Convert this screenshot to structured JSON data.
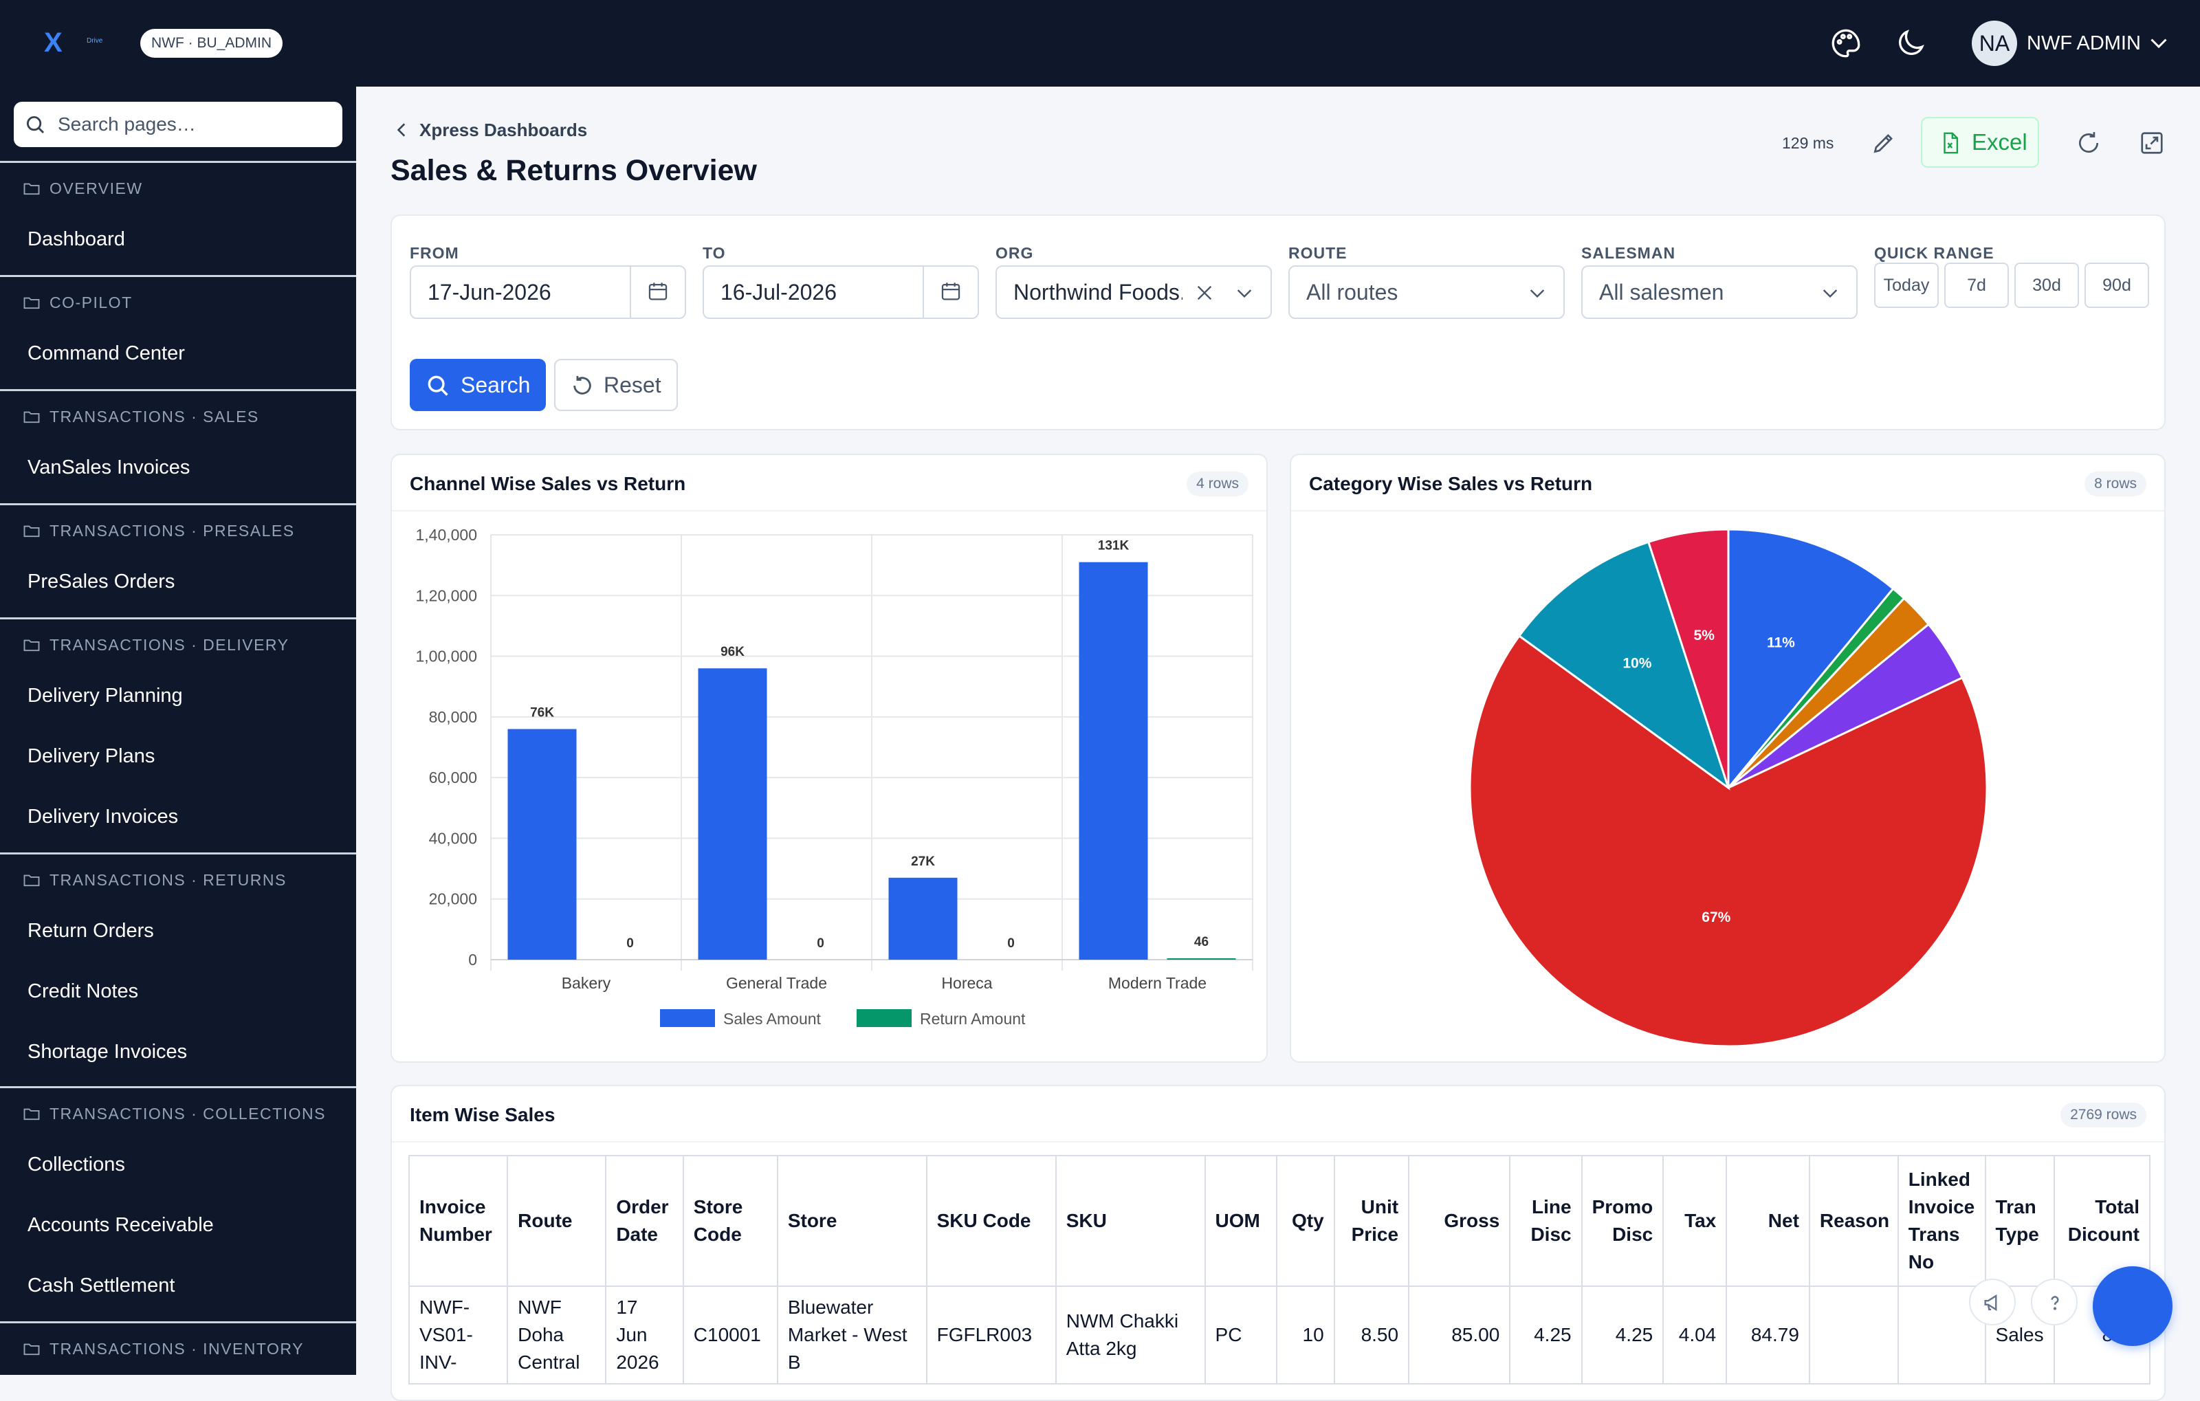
{
  "brand": {
    "logo_text": "X",
    "logo_sub": "Drive"
  },
  "tenant_badge": "NWF · BU_ADMIN",
  "user": {
    "initials": "NA",
    "name": "NWF ADMIN"
  },
  "sidebar": {
    "search_placeholder": "Search pages…",
    "sections": [
      {
        "title": "OVERVIEW",
        "items": [
          "Dashboard"
        ]
      },
      {
        "title": "CO-PILOT",
        "items": [
          "Command Center"
        ]
      },
      {
        "title": "TRANSACTIONS · SALES",
        "items": [
          "VanSales Invoices"
        ]
      },
      {
        "title": "TRANSACTIONS · PRESALES",
        "items": [
          "PreSales Orders"
        ]
      },
      {
        "title": "TRANSACTIONS · DELIVERY",
        "items": [
          "Delivery Planning",
          "Delivery Plans",
          "Delivery Invoices"
        ]
      },
      {
        "title": "TRANSACTIONS · RETURNS",
        "items": [
          "Return Orders",
          "Credit Notes",
          "Shortage Invoices"
        ]
      },
      {
        "title": "TRANSACTIONS · COLLECTIONS",
        "items": [
          "Collections",
          "Accounts Receivable",
          "Cash Settlement"
        ]
      },
      {
        "title": "TRANSACTIONS · INVENTORY",
        "items": []
      }
    ]
  },
  "header": {
    "back_label": "Xpress Dashboards",
    "title": "Sales & Returns Overview",
    "timing": "129 ms",
    "excel_label": "Excel"
  },
  "filters": {
    "from": {
      "label": "FROM",
      "value": "17-Jun-2026"
    },
    "to": {
      "label": "TO",
      "value": "16-Jul-2026"
    },
    "org": {
      "label": "ORG",
      "value": "Northwind Foods..."
    },
    "route": {
      "label": "ROUTE",
      "value": "All routes"
    },
    "salesman": {
      "label": "SALESMAN",
      "value": "All salesmen"
    },
    "quick_range": {
      "label": "QUICK RANGE",
      "options": [
        "Today",
        "7d",
        "30d",
        "90d"
      ]
    },
    "search_label": "Search",
    "reset_label": "Reset"
  },
  "chart1_card": {
    "title": "Channel Wise Sales vs Return",
    "rows": "4 rows"
  },
  "chart2_card": {
    "title": "Category Wise Sales vs Return",
    "rows": "8 rows"
  },
  "table_card": {
    "title": "Item Wise Sales",
    "rows": "2769 rows"
  },
  "chart_data": [
    {
      "type": "bar",
      "categories": [
        "Bakery",
        "General Trade",
        "Horeca",
        "Modern Trade"
      ],
      "series": [
        {
          "name": "Sales Amount",
          "color": "#2563eb",
          "values": [
            76000,
            96000,
            27000,
            131000
          ],
          "labels": [
            "76K",
            "96K",
            "27K",
            "131K"
          ]
        },
        {
          "name": "Return Amount",
          "color": "#059669",
          "values": [
            0,
            0,
            0,
            46
          ],
          "labels": [
            "0",
            "0",
            "0",
            "46"
          ]
        }
      ],
      "ylim": [
        0,
        140000
      ],
      "yticks": [
        "0",
        "20,000",
        "40,000",
        "60,000",
        "80,000",
        "1,00,000",
        "1,20,000",
        "1,40,000"
      ],
      "grid": true,
      "legend": "bottom"
    },
    {
      "type": "pie",
      "slices": [
        {
          "value": 11,
          "label": "11%",
          "color": "#2563eb"
        },
        {
          "value": 0.9,
          "label": "",
          "color": "#16a34a"
        },
        {
          "value": 2.2,
          "label": "",
          "color": "#d97706"
        },
        {
          "value": 3.9,
          "label": "",
          "color": "#7c3aed"
        },
        {
          "value": 67,
          "label": "67%",
          "color": "#dc2626"
        },
        {
          "value": 10,
          "label": "10%",
          "color": "#0891b2"
        },
        {
          "value": 5,
          "label": "5%",
          "color": "#e11d48"
        }
      ]
    }
  ],
  "table": {
    "columns": [
      {
        "label": "Invoice Number",
        "align": "l"
      },
      {
        "label": "Route",
        "align": "l"
      },
      {
        "label": "Order Date",
        "align": "l"
      },
      {
        "label": "Store Code",
        "align": "l"
      },
      {
        "label": "Store",
        "align": "l"
      },
      {
        "label": "SKU Code",
        "align": "l"
      },
      {
        "label": "SKU",
        "align": "l"
      },
      {
        "label": "UOM",
        "align": "l"
      },
      {
        "label": "Qty",
        "align": "r"
      },
      {
        "label": "Unit Price",
        "align": "r"
      },
      {
        "label": "Gross",
        "align": "r"
      },
      {
        "label": "Line Disc",
        "align": "r"
      },
      {
        "label": "Promo Disc",
        "align": "r"
      },
      {
        "label": "Tax",
        "align": "r"
      },
      {
        "label": "Net",
        "align": "r"
      },
      {
        "label": "Reason",
        "align": "l"
      },
      {
        "label": "Linked Invoice Trans No",
        "align": "l"
      },
      {
        "label": "Tran Type",
        "align": "l"
      },
      {
        "label": "Total Dicount",
        "align": "r"
      }
    ],
    "rows": [
      [
        "NWF-VS01-INV-",
        "NWF Doha Central",
        "17 Jun 2026",
        "C10001",
        "Bluewater Market - West B",
        "FGFLR003",
        "NWM Chakki Atta 2kg",
        "PC",
        "10",
        "8.50",
        "85.00",
        "4.25",
        "4.25",
        "4.04",
        "84.79",
        "",
        "",
        "Sales",
        "8.50"
      ]
    ]
  }
}
